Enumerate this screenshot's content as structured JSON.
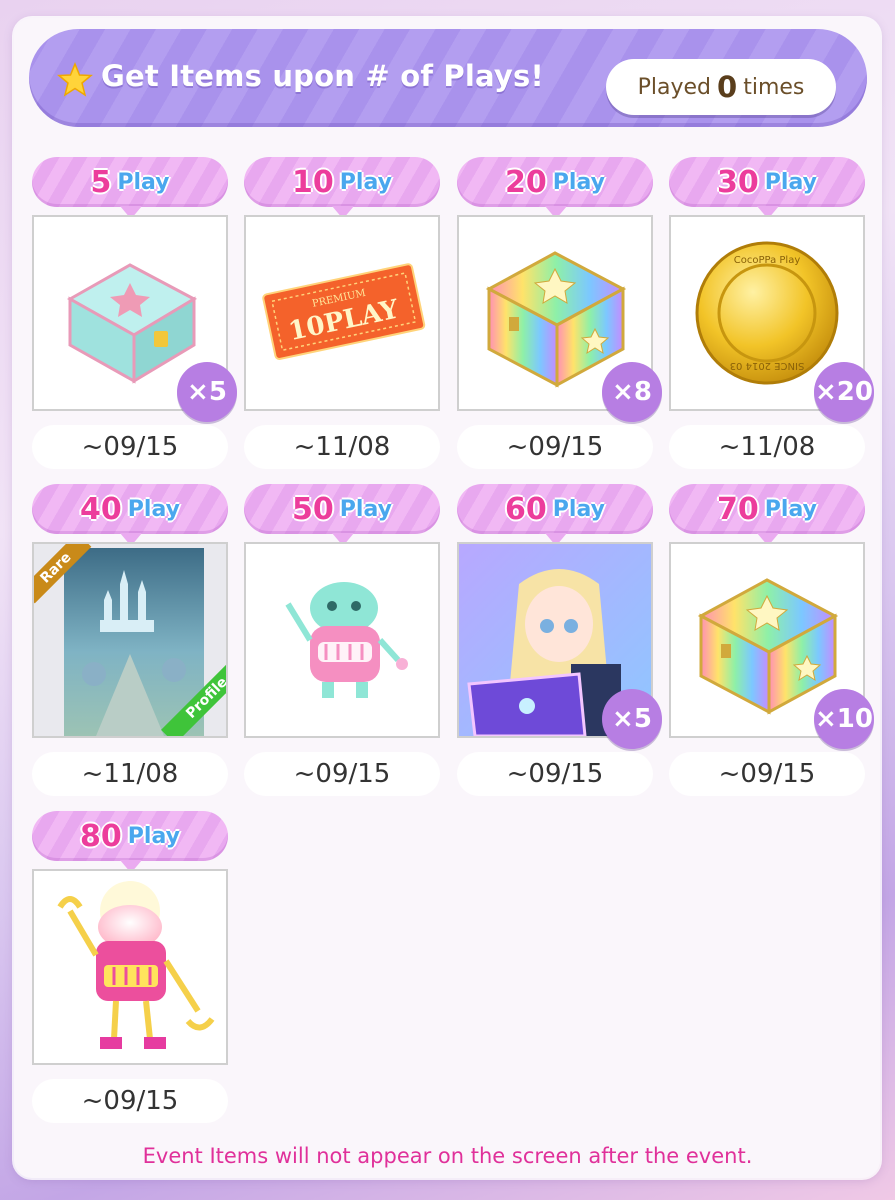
{
  "header": {
    "title": "Get Items upon # of Plays!",
    "played_prefix": "Played",
    "played_count": "0",
    "played_suffix": "times"
  },
  "colors": {
    "accent": "#a992ec",
    "tag_pink": "#ec3d9c",
    "tag_blue": "#4aa7ee",
    "footer_text": "#e0309a"
  },
  "rewards": [
    {
      "plays": "5",
      "play_label": "Play",
      "item": "star-chest-icon",
      "qty": "×5",
      "date": "~09/15"
    },
    {
      "plays": "10",
      "play_label": "Play",
      "item": "10-play-ticket-icon",
      "ticket_text": "10PLAY",
      "ticket_small": "PREMIUM",
      "date": "~11/08"
    },
    {
      "plays": "20",
      "play_label": "Play",
      "item": "rainbow-chest-icon",
      "qty": "×8",
      "date": "~09/15"
    },
    {
      "plays": "30",
      "play_label": "Play",
      "item": "gold-coin-icon",
      "qty": "×20",
      "coin_text_top": "CocoPPa Play",
      "coin_text_bottom": "SINCE 2014 03",
      "date": "~11/08"
    },
    {
      "plays": "40",
      "play_label": "Play",
      "item": "castle-profile-background-icon",
      "rare_label": "Rare",
      "profile_label": "Profile",
      "date": "~11/08"
    },
    {
      "plays": "50",
      "play_label": "Play",
      "item": "robot-mint-icon",
      "date": "~09/15"
    },
    {
      "plays": "60",
      "play_label": "Play",
      "item": "girl-card-icon",
      "qty": "×5",
      "date": "~09/15"
    },
    {
      "plays": "70",
      "play_label": "Play",
      "item": "rainbow-chest-icon",
      "qty": "×10",
      "date": "~09/15"
    },
    {
      "plays": "80",
      "play_label": "Play",
      "item": "robot-pink-icon",
      "date": "~09/15"
    }
  ],
  "footer": {
    "note": "Event Items will not appear on the screen after the event."
  }
}
